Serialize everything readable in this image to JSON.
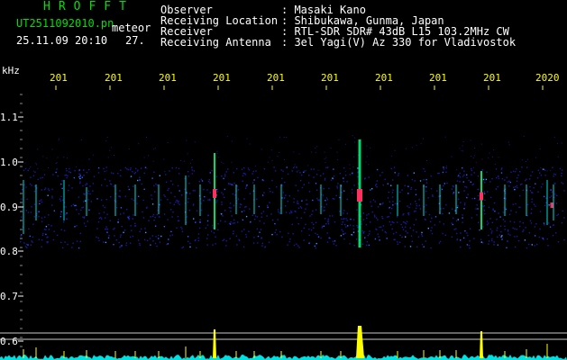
{
  "header": {
    "app_title": "HROFFT",
    "filename": "UT2511092010.pn",
    "meteor_label": "meteor",
    "timestamp": "25.11.09 20:10",
    "count": "27.",
    "info_rows": [
      {
        "label": "Observer",
        "value": ": Masaki Kano"
      },
      {
        "label": "Receiving Location",
        "value": ": Shibukawa, Gunma, Japan"
      },
      {
        "label": "Receiver",
        "value": ": RTL-SDR SDR# 43dB L15 103.2MHz CW"
      },
      {
        "label": "Receiving Antenna",
        "value": ": 3el Yagi(V) Az 330 for Vladivostok"
      }
    ]
  },
  "axes": {
    "y_unit": "kHz",
    "y_ticks": [
      "1.1",
      "1.0",
      "0.9",
      "0.8",
      "0.7",
      "0.6"
    ],
    "x_ticks": [
      "201",
      "201",
      "201",
      "201",
      "201",
      "201",
      "201",
      "201",
      "201",
      "2020"
    ]
  },
  "colors": {
    "noise": "#1a1aa0",
    "signal": "#00ffff",
    "strong": "#ff3060",
    "echo_bar": "#ffff00",
    "baseline": "#00e0e0"
  }
}
